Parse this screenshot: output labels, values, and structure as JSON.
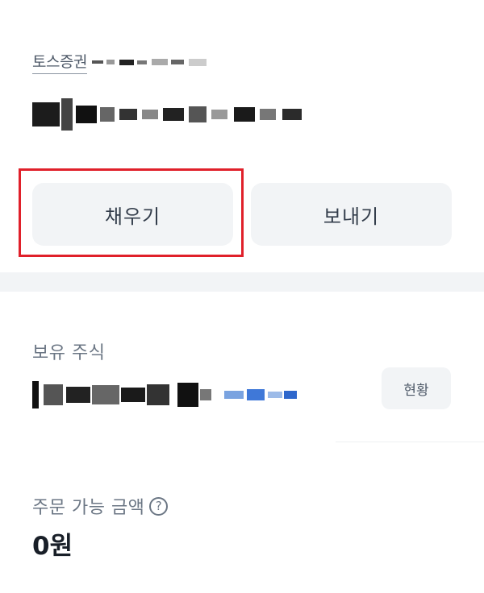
{
  "account": {
    "broker_name": "토스증권",
    "fill_button": "채우기",
    "send_button": "보내기"
  },
  "holdings": {
    "label": "보유 주식",
    "status_button": "현황"
  },
  "orderable": {
    "label": "주문 가능 금액",
    "help_icon": "?",
    "value": "0원"
  },
  "colors": {
    "highlight": "#e0202a",
    "button_bg": "#f2f4f6",
    "primary_text": "#191f28",
    "secondary_text": "#6b7684"
  }
}
